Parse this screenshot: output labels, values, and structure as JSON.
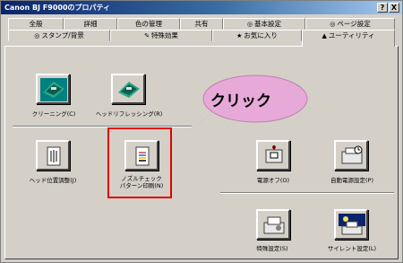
{
  "window": {
    "title": "Canon BJ F9000のプロパティ",
    "help_btn": "?",
    "close_btn": "X"
  },
  "tabs_row1": [
    {
      "label": "全般"
    },
    {
      "label": "詳細"
    },
    {
      "label": "色の管理"
    },
    {
      "label": "共有"
    },
    {
      "label": "基本設定",
      "icon": "◎"
    },
    {
      "label": "ページ設定",
      "icon": "◎"
    }
  ],
  "tabs_row2": [
    {
      "label": "スタンプ/背景",
      "icon": "◎"
    },
    {
      "label": "特殊効果",
      "icon": "✎"
    },
    {
      "label": "お気に入り",
      "icon": "★"
    },
    {
      "label": "ユーティリティ",
      "icon": "▲"
    }
  ],
  "utilities": {
    "cleaning": "クリーニング(C)",
    "refreshing": "ヘッドリフレッシング(R)",
    "head_alignment": "ヘッド位置調整(J)",
    "nozzle_check_line1": "ノズルチェック",
    "nozzle_check_line2": "パターン印刷(N)",
    "power_off": "電源オフ(O)",
    "auto_power": "自動電源設定(P)",
    "special_settings": "特殊設定(S)",
    "silent_settings": "サイレント設定(L)"
  },
  "callout": {
    "text": "クリック"
  },
  "colors": {
    "highlight": "#e00000",
    "bubble": "#e6a9d8",
    "title_bar": "#0a246a"
  }
}
